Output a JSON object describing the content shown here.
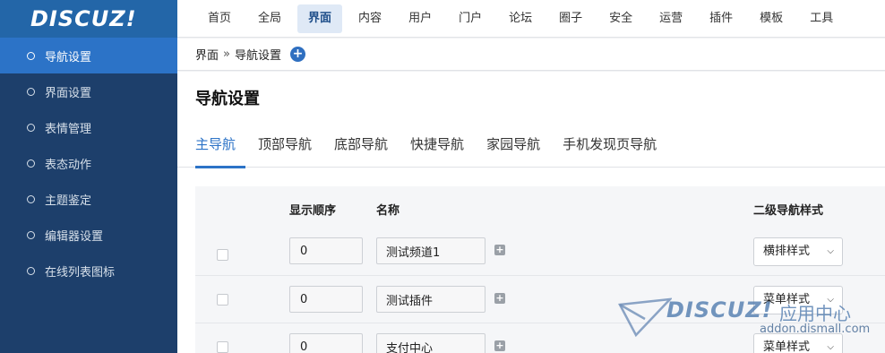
{
  "logo": {
    "text": "DISCUZ!"
  },
  "topnav": {
    "items": [
      "首页",
      "全局",
      "界面",
      "内容",
      "用户",
      "门户",
      "论坛",
      "圈子",
      "安全",
      "运营",
      "插件",
      "模板",
      "工具"
    ]
  },
  "sidebar": {
    "items": [
      "导航设置",
      "界面设置",
      "表情管理",
      "表态动作",
      "主题鉴定",
      "编辑器设置",
      "在线列表图标"
    ]
  },
  "breadcrumb": {
    "part1": "界面",
    "sep": "»",
    "part2": "导航设置",
    "add_icon": "plus-circle-icon"
  },
  "page": {
    "title": "导航设置"
  },
  "tabs": [
    "主导航",
    "顶部导航",
    "底部导航",
    "快捷导航",
    "家园导航",
    "手机发现页导航"
  ],
  "table": {
    "headers": {
      "order": "显示顺序",
      "name": "名称",
      "style": "二级导航样式"
    },
    "rows": [
      {
        "order": "0",
        "name": "测试频道1",
        "style": "横排样式"
      },
      {
        "order": "0",
        "name": "测试插件",
        "style": "菜单样式"
      },
      {
        "order": "0",
        "name": "支付中心",
        "style": "菜单样式"
      }
    ]
  },
  "watermark": {
    "logo": "DISCUZ!",
    "cn": "应用中心",
    "url": "addon.dismall.com"
  },
  "colors": {
    "sidebar": "#1d3f6b",
    "accent": "#2c73c7",
    "logo_bg": "#2366a8"
  }
}
